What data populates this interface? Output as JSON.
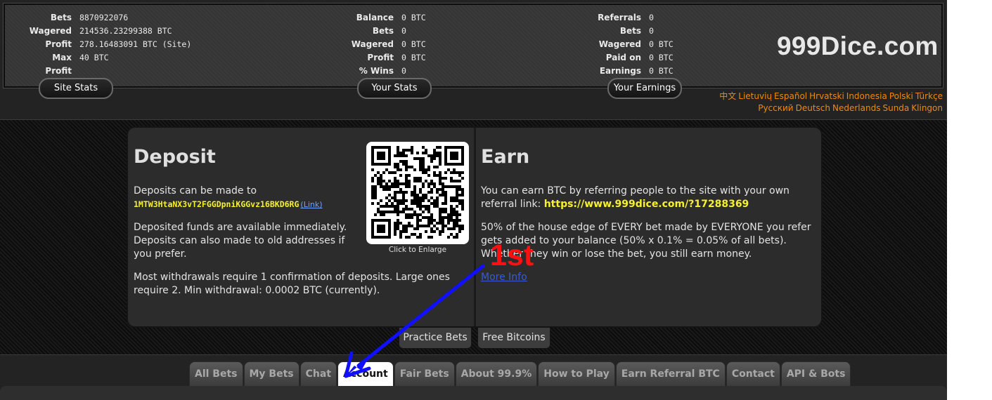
{
  "header": {
    "logo": "999Dice.com",
    "site_stats": {
      "rows": [
        {
          "label": "Bets",
          "value": "8870922076"
        },
        {
          "label": "Wagered",
          "value": "214536.23299388 BTC"
        },
        {
          "label": "Profit",
          "value": "278.16483091 BTC (Site)"
        },
        {
          "label": "Max Profit",
          "value": "40 BTC"
        }
      ],
      "button": "Site Stats"
    },
    "your_stats": {
      "rows": [
        {
          "label": "Balance",
          "value": "0 BTC"
        },
        {
          "label": "Bets",
          "value": "0"
        },
        {
          "label": "Wagered",
          "value": "0 BTC"
        },
        {
          "label": "Profit",
          "value": "0 BTC"
        },
        {
          "label": "% Wins",
          "value": "0"
        }
      ],
      "button": "Your Stats"
    },
    "your_earnings": {
      "rows": [
        {
          "label": "Referrals",
          "value": "0"
        },
        {
          "label": "Bets",
          "value": "0"
        },
        {
          "label": "Wagered",
          "value": "0 BTC"
        },
        {
          "label": "Paid on",
          "value": "0 BTC"
        },
        {
          "label": "Earnings",
          "value": "0 BTC"
        }
      ],
      "button": "Your Earnings"
    },
    "languages": {
      "line1": [
        "中文",
        "Lietuvių",
        "Español",
        "Hrvatski",
        "Indonesia",
        "Polski",
        "Türkçe"
      ],
      "line2": [
        "Русский",
        "Deutsch",
        "Nederlands",
        "Sunda",
        "Klingon"
      ]
    }
  },
  "deposit": {
    "title": "Deposit",
    "p1_text": "Deposits can be made to",
    "address": "1MTW3HtaNX3vT2FGGDpniKGGvz16BKD6RG",
    "address_link": "(Link)",
    "p2": "Deposited funds are available immediately. Deposits can also made to old addresses if you prefer.",
    "p3": "Most withdrawals require 1 confirmation of deposits. Large ones require 2. Min withdrawal: 0.0002 BTC (currently).",
    "qr_caption": "Click to Enlarge",
    "qr_icon": "qr-code-icon"
  },
  "earn": {
    "title": "Earn",
    "p1_text": "You can earn BTC by referring people to the site with your own referral link:",
    "referral_link": "https://www.999dice.com/?17288369",
    "p2": "50% of the house edge of EVERY bet made by EVERYONE you refer gets added to your balance (50% x 0.1% = 0.05% of all bets). Whether they win or lose the bet, you still earn money.",
    "more_info": "More Info"
  },
  "sub_buttons": {
    "practice": "Practice Bets",
    "free": "Free Bitcoins"
  },
  "tabs": [
    {
      "label": "All Bets",
      "active": false
    },
    {
      "label": "My Bets",
      "active": false
    },
    {
      "label": "Chat",
      "active": false
    },
    {
      "label": "Account",
      "active": true
    },
    {
      "label": "Fair Bets",
      "active": false
    },
    {
      "label": "About 99.9%",
      "active": false
    },
    {
      "label": "How to Play",
      "active": false
    },
    {
      "label": "Earn Referral BTC",
      "active": false
    },
    {
      "label": "Contact",
      "active": false
    },
    {
      "label": "API & Bots",
      "active": false
    }
  ],
  "annotation": {
    "label": "1st",
    "color": "#ff1010",
    "arrow_color": "#1010ff"
  },
  "colors": {
    "accent_orange": "#f08a0e",
    "address_yellow": "#f6f12c",
    "link_blue": "#3a5bd0"
  }
}
